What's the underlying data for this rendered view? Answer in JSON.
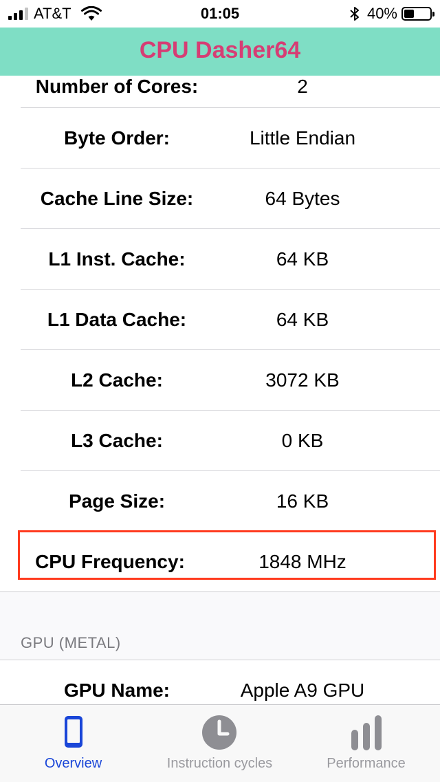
{
  "status_bar": {
    "carrier": "AT&T",
    "time": "01:05",
    "battery": "40%",
    "battery_level": 0.4,
    "signal_bars": 4,
    "signal_filled": 3
  },
  "app": {
    "title": "CPU Dasher64",
    "title_color": "#d63d74",
    "header_color": "#7fdec5"
  },
  "rows": [
    {
      "label": "Number of Cores:",
      "value": "2"
    },
    {
      "label": "Byte Order:",
      "value": "Little Endian"
    },
    {
      "label": "Cache Line Size:",
      "value": "64 Bytes"
    },
    {
      "label": "L1 Inst. Cache:",
      "value": "64 KB"
    },
    {
      "label": "L1 Data Cache:",
      "value": "64 KB"
    },
    {
      "label": "L2 Cache:",
      "value": "3072 KB"
    },
    {
      "label": "L3 Cache:",
      "value": "0 KB"
    },
    {
      "label": "Page Size:",
      "value": "16 KB"
    },
    {
      "label": "CPU Frequency:",
      "value": "1848 MHz"
    }
  ],
  "gpu_section": {
    "header": "GPU (METAL)",
    "rows": [
      {
        "label": "GPU Name:",
        "value": "Apple A9 GPU"
      }
    ]
  },
  "tabs": [
    {
      "label": "Overview",
      "icon": "phone-icon",
      "active": true
    },
    {
      "label": "Instruction cycles",
      "icon": "clock-icon",
      "active": false
    },
    {
      "label": "Performance",
      "icon": "bar-chart-icon",
      "active": false
    }
  ],
  "colors": {
    "accent_active": "#1a46d8",
    "inactive": "#9a9a9f",
    "highlight_border": "#ff3b1f"
  }
}
